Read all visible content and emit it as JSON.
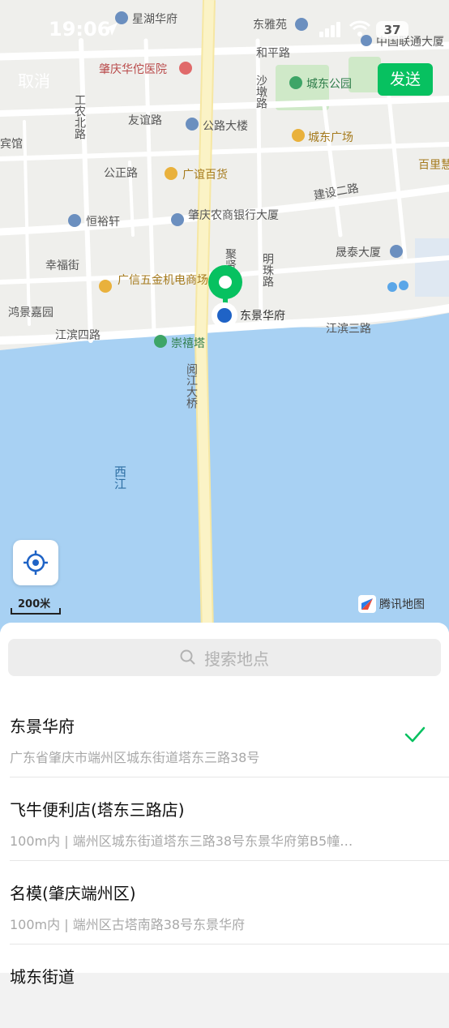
{
  "status_bar": {
    "time": "19:06",
    "battery": "37"
  },
  "header": {
    "cancel_label": "取消",
    "send_label": "发送"
  },
  "map": {
    "labels": {
      "xinghu": "星湖华府",
      "dongyayuan": "东雅苑",
      "heping": "和平路",
      "unicom": "中国联通大厦",
      "hospital": "肇庆华佗医院",
      "shadun": "沙墩路",
      "chengdong_park": "城东公园",
      "gongnong": "工农北路",
      "youyi": "友谊路",
      "gonglu_tower": "公路大楼",
      "chengdong_square": "城东广场",
      "hotel": "宾馆",
      "baishun": "百里慧",
      "gongzheng": "公正路",
      "guangyi": "广谊百货",
      "jianshe": "建设二路",
      "hengyu": "恒裕轩",
      "nongshang": "肇庆农商银行大厦",
      "xingfu": "幸福街",
      "juxian": "聚贤",
      "mingzhu": "明珠路",
      "shengtai": "晟泰大厦",
      "guangxin": "广信五金机电商场",
      "dongjing_pin": "东景华府",
      "hongjing": "鸿景嘉园",
      "jiangbin4": "江滨四路",
      "chongxi": "崇禧塔",
      "jiangbin3": "江滨三路",
      "yuejiang": "阅江大桥",
      "xijiang": "西江"
    },
    "scale": "200米",
    "logo": "腾讯地图"
  },
  "search": {
    "placeholder": "搜索地点"
  },
  "results": [
    {
      "name": "东景华府",
      "address": "广东省肇庆市端州区城东街道塔东三路38号",
      "selected": true
    },
    {
      "name": "飞牛便利店(塔东三路店)",
      "address": "100m内 | 端州区城东街道塔东三路38号东景华府第B5幢…"
    },
    {
      "name": "名模(肇庆端州区)",
      "address": "100m内 | 端州区古塔南路38号东景华府"
    },
    {
      "name": "城东街道",
      "address": ""
    }
  ],
  "colors": {
    "accent": "#07c160",
    "water": "#a8d1f3",
    "land": "#efefec",
    "road": "#ffffff",
    "bridge": "#fbf3c6",
    "park": "#cfe9c8"
  }
}
